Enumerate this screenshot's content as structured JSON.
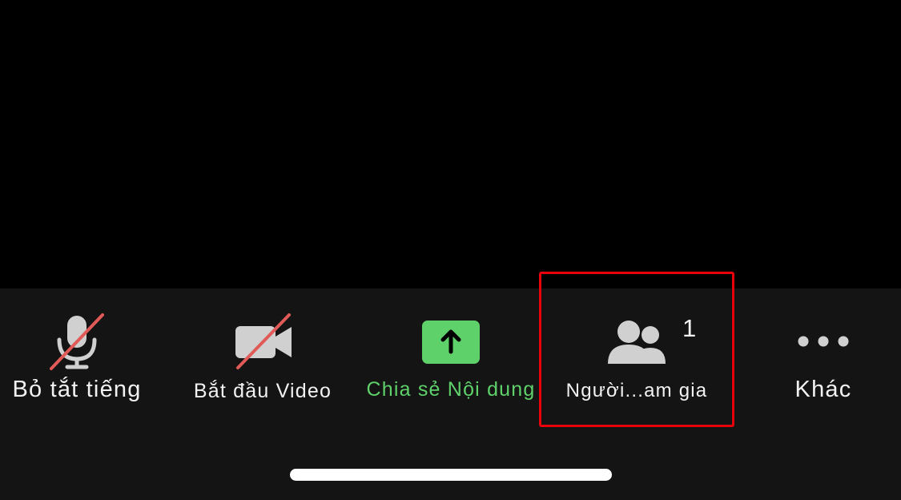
{
  "toolbar": {
    "mute_label": "Bỏ tắt tiếng",
    "video_label": "Bắt đầu Video",
    "share_label": "Chia sẻ Nội dung",
    "participants_label": "Người...am gia",
    "participants_count": "1",
    "more_label": "Khác"
  },
  "icons": {
    "mute": "microphone-off-icon",
    "video": "video-camera-off-icon",
    "share": "share-arrow-icon",
    "participants": "people-icon",
    "more": "more-dots-icon"
  },
  "colors": {
    "toolbar_bg": "#141414",
    "share_accent": "#5fd16a",
    "slash_red": "#e05a57",
    "highlight_red": "#e8000b",
    "icon_gray": "#d0d0d0"
  }
}
